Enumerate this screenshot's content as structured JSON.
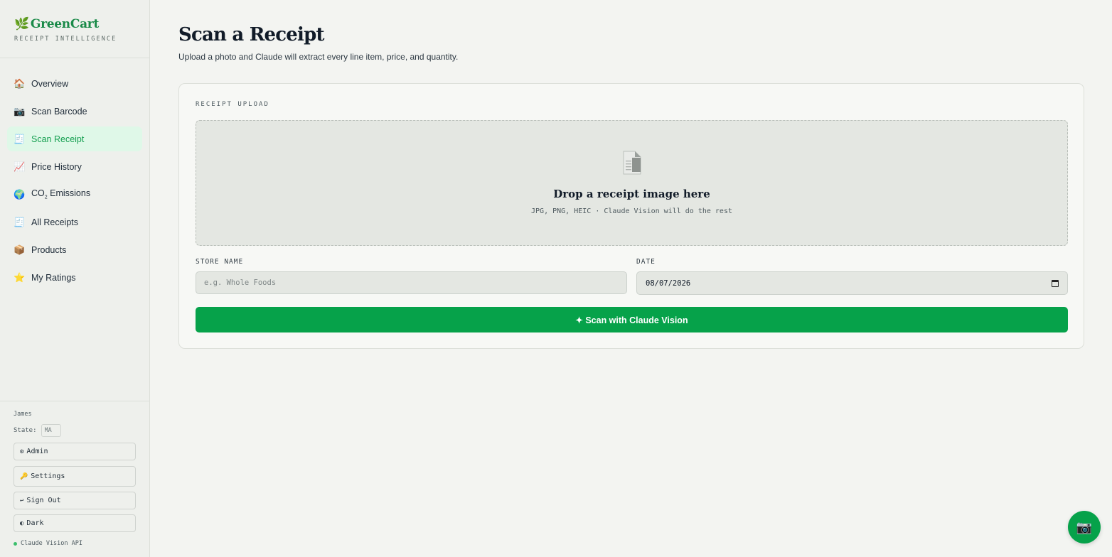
{
  "brand": {
    "name": "GreenCart",
    "tagline": "RECEIPT INTELLIGENCE",
    "logo_icon": "🌿"
  },
  "nav": [
    {
      "icon": "🏠",
      "label": "Overview",
      "active": false
    },
    {
      "icon": "📷",
      "label": "Scan Barcode",
      "active": false
    },
    {
      "icon": "🧾",
      "label": "Scan Receipt",
      "active": true
    },
    {
      "icon": "📈",
      "label": "Price History",
      "active": false
    },
    {
      "icon": "🌍",
      "label_pre": "CO",
      "label_sub": "2",
      "label_post": " Emissions",
      "active": false
    },
    {
      "icon": "🧾",
      "label": "All Receipts",
      "active": false
    },
    {
      "icon": "📦",
      "label": "Products",
      "active": false
    },
    {
      "icon": "⭐",
      "label": "My Ratings",
      "active": false
    }
  ],
  "sidebar_bottom": {
    "user": "James",
    "state_label": "State:",
    "state_value": "MA",
    "buttons": [
      {
        "icon": "⚙",
        "label": "Admin"
      },
      {
        "icon": "🔑",
        "label": "Settings"
      },
      {
        "icon": "↩",
        "label": "Sign Out"
      },
      {
        "icon": "◐",
        "label": "Dark"
      }
    ],
    "api_status": "Claude Vision API",
    "api_status_color": "#3bbf6c"
  },
  "main": {
    "title": "Scan a Receipt",
    "subtitle": "Upload a photo and Claude will extract every line item, price, and quantity.",
    "card_label": "RECEIPT UPLOAD",
    "dropzone": {
      "title": "Drop a receipt image here",
      "subtitle": "JPG, PNG, HEIC · Claude Vision will do the rest"
    },
    "store_label": "STORE NAME",
    "store_placeholder": "e.g. Whole Foods",
    "store_value": "",
    "date_label": "DATE",
    "date_value": "08/07/2026",
    "scan_button": "✦ Scan with Claude Vision"
  },
  "fab_icon": "📷",
  "colors": {
    "accent": "#06a24a",
    "active_nav_bg": "#dff8e8",
    "active_nav_text": "#16a051"
  }
}
